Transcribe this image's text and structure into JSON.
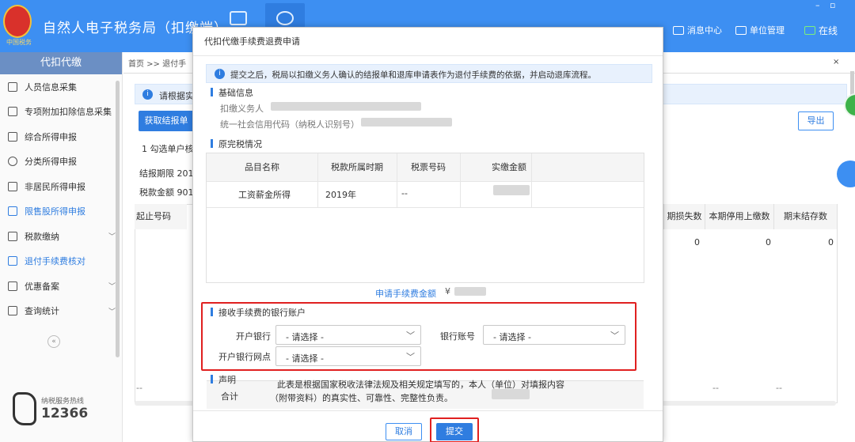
{
  "header": {
    "app_title": "自然人电子税务局（扣缴端）",
    "emblem_text": "中国税务",
    "msg_center": "消息中心",
    "unit_mgmt": "单位管理",
    "online": "在线",
    "win_min": "–",
    "win_max": "▫"
  },
  "sidebar": {
    "title": "代扣代缴",
    "items": [
      {
        "label": "人员信息采集",
        "icon": "person-icon"
      },
      {
        "label": "专项附加扣除信息采集",
        "icon": "list-icon"
      },
      {
        "label": "综合所得申报",
        "icon": "layers-icon"
      },
      {
        "label": "分类所得申报",
        "icon": "pie-icon"
      },
      {
        "label": "非居民所得申报",
        "icon": "person-globe-icon"
      },
      {
        "label": "限售股所得申报",
        "icon": "bar-chart-icon"
      },
      {
        "label": "税款缴纳",
        "icon": "folder-icon"
      },
      {
        "label": "退付手续费核对",
        "icon": "document-icon"
      },
      {
        "label": "优惠备案",
        "icon": "copy-icon"
      },
      {
        "label": "查询统计",
        "icon": "search-list-icon"
      }
    ],
    "collapse": "«",
    "hotline_label": "纳税服务热线",
    "hotline_number": "12366"
  },
  "background": {
    "breadcrumb": "首页 >> 退付手",
    "info": "请根据实",
    "fetch_button": "获取结报单",
    "step": "1 勾选单户核",
    "period": "结报期限 201",
    "amount": "税款金额 901",
    "export": "导出",
    "col_left": "起止号码",
    "col_headers": [
      "期损失数",
      "本期停用上缴数",
      "期末结存数"
    ],
    "row_values": [
      "0",
      "0",
      "0"
    ],
    "dash": "--",
    "close": "×"
  },
  "modal": {
    "title": "代扣代缴手续费退费申请",
    "note": "提交之后，税局以扣缴义务人确认的结报单和退库申请表作为退付手续费的依据，并启动退库流程。",
    "basic_title": "基础信息",
    "withholder_label": "扣缴义务人",
    "credit_code_label": "统一社会信用代码（纳税人识别号）",
    "tax_title": "原完税情况",
    "table_headers": [
      "品目名称",
      "税款所属时期",
      "税票号码",
      "实缴金额"
    ],
    "row": {
      "item": "工资薪金所得",
      "period": "2019年",
      "ticket": "--"
    },
    "total_label": "合计",
    "total_dash1": "--",
    "total_dash2": "--",
    "apply_label": "申请手续费金额",
    "currency": "¥",
    "bank_title": "接收手续费的银行账户",
    "bank_label": "开户银行",
    "account_label": "银行账号",
    "branch_label": "开户银行网点",
    "select_placeholder": "- 请选择 -",
    "decl_title": "声明",
    "decl_line1": "此表是根据国家税收法律法规及相关规定填写的，本人（单位）对填报内容",
    "decl_line2": "（附带资料）的真实性、可靠性、完整性负责。",
    "cancel": "取消",
    "submit": "提交"
  },
  "colors": {
    "primary": "#2f7de0",
    "header": "#3d8ff2",
    "highlight": "#e02020"
  }
}
